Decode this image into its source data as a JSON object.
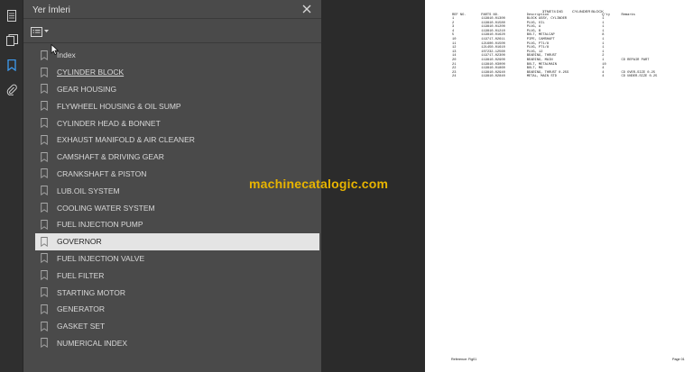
{
  "panel": {
    "title": "Yer İmleri",
    "close_glyph": "✕"
  },
  "icons": {
    "pages": "pages-icon",
    "bookmarks": "bookmark-icon",
    "attachments": "attachment-icon",
    "options": "list-options-icon",
    "close": "close-icon"
  },
  "colors": {
    "accent": "#3d9bf0",
    "panel_bg": "#4a4a4a",
    "selected_bg": "#e4e4e4",
    "watermark": "#e8b400"
  },
  "bookmarks": [
    {
      "label": "Index"
    },
    {
      "label": "CYLINDER BLOCK"
    },
    {
      "label": "GEAR HOUSING"
    },
    {
      "label": "FLYWHEEL HOUSING & OIL SUMP"
    },
    {
      "label": "CYLINDER HEAD & BONNET"
    },
    {
      "label": "EXHAUST MANIFOLD & AIR CLEANER"
    },
    {
      "label": "CAMSHAFT & DRIVING GEAR"
    },
    {
      "label": "CRANKSHAFT & PISTON"
    },
    {
      "label": "LUB.OIL SYSTEM"
    },
    {
      "label": "COOLING WATER SYSTEM"
    },
    {
      "label": "FUEL INJECTION PUMP"
    },
    {
      "label": "GOVERNOR"
    },
    {
      "label": "FUEL INJECTION VALVE"
    },
    {
      "label": "FUEL FILTER"
    },
    {
      "label": "STARTING MOTOR"
    },
    {
      "label": "GENERATOR"
    },
    {
      "label": "GASKET SET"
    },
    {
      "label": "NUMERICAL INDEX"
    }
  ],
  "selected_bookmark": "GOVERNOR",
  "watermark_text": "machinecatalogic.com",
  "document_page": {
    "header_left": "3TNE74 DIG",
    "header_right": "CYLINDER BLOCK",
    "columns": [
      "REF NO.",
      "PARTS NO.",
      "Description",
      "Q'ty",
      "Remarks"
    ],
    "rows": [
      [
        "1",
        "119810-01300",
        "BLOCK ASSY, CYLINDER",
        "1",
        ""
      ],
      [
        "2",
        "119810-01580",
        "PLUG, OIL",
        "1",
        ""
      ],
      [
        "3",
        "119810-01200",
        "PLUG, A",
        "1",
        ""
      ],
      [
        "4",
        "119810-01210",
        "PLUG, B",
        "1",
        ""
      ],
      [
        "5",
        "119810-01620",
        "BOLT, METALCAP",
        "8",
        ""
      ],
      [
        "10",
        "119717-02611",
        "PIPE, CAMSHAFT",
        "1",
        ""
      ],
      [
        "11",
        "121600-01500",
        "PLUG, PT1/8",
        "1",
        ""
      ],
      [
        "12",
        "121450-01610",
        "PLUG, PT1/8",
        "1",
        ""
      ],
      [
        "13",
        "107232-12560",
        "PLUG, 12",
        "1",
        ""
      ],
      [
        "14",
        "119717-02300",
        "BEARING, THRUST",
        "2",
        ""
      ],
      [
        "20",
        "119810-02900",
        "BEARING, MAIN",
        "1",
        "CD REPAIR PART"
      ],
      [
        "21",
        "119810-03000",
        "BOLT, METALMAIN",
        "10",
        ""
      ],
      [
        "22",
        "119810-01860",
        "BOLT, M8",
        "4",
        ""
      ],
      [
        "23",
        "119810-02940",
        "BEARING, THRUST 0.25S",
        "4",
        "CD OVER-SIZE 0.25"
      ],
      [
        "24",
        "119810-02840",
        "METAL, MAIN STD",
        "4",
        "CD UNDER-SIZE 0.25"
      ]
    ],
    "footer_left": "Reference: Fig01",
    "footer_right": "Page 01"
  }
}
